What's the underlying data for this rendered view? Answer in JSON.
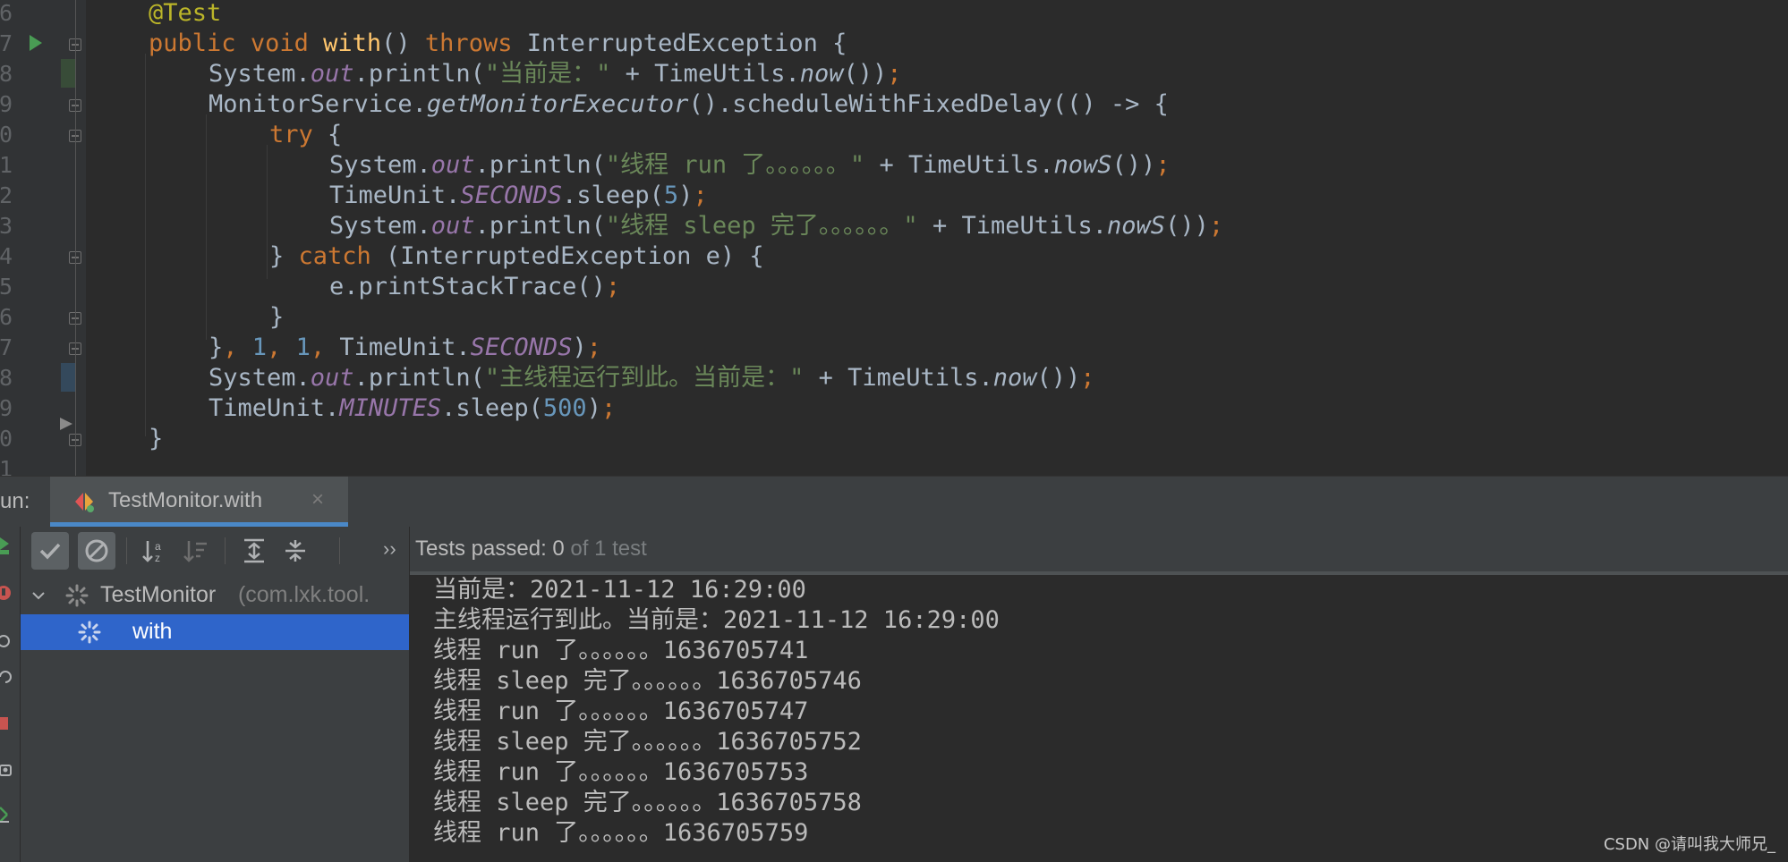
{
  "editor": {
    "line_numbers": [
      "6",
      "7",
      "8",
      "9",
      "0",
      "1",
      "2",
      "3",
      "4",
      "5",
      "6",
      "7",
      "8",
      "9",
      "0",
      "1"
    ],
    "code": {
      "l6": {
        "annotation": "@Test"
      },
      "l7": {
        "kw1": "public",
        "kw2": "void",
        "method": "with",
        "p1": "()",
        "kw3": "throws",
        "rest": "InterruptedException {"
      },
      "l8": {
        "t1": "System.",
        "field": "out",
        "t2": ".println(",
        "str": "\"当前是：\"",
        "t3": " + TimeUtils.",
        "stat": "now",
        "t4": "())",
        "semi": ";"
      },
      "l9": {
        "t1": "MonitorService.",
        "stat": "getMonitorExecutor",
        "t2": "().scheduleWithFixedDelay(() -> {"
      },
      "l10": {
        "kw": "try",
        "t1": " {"
      },
      "l11": {
        "t1": "System.",
        "field": "out",
        "t2": ".println(",
        "str": "\"线程 run 了。。。。。。\"",
        "t3": " + TimeUtils.",
        "stat": "nowS",
        "t4": "())",
        "semi": ";"
      },
      "l12": {
        "t1": "TimeUnit.",
        "const": "SECONDS",
        "t2": ".sleep(",
        "num": "5",
        "t3": ")",
        "semi": ";"
      },
      "l13": {
        "t1": "System.",
        "field": "out",
        "t2": ".println(",
        "str": "\"线程 sleep 完了。。。。。。\"",
        "t3": " + TimeUtils.",
        "stat": "nowS",
        "t4": "())",
        "semi": ";"
      },
      "l14": {
        "t1": "} ",
        "kw": "catch",
        "t2": " (InterruptedException e) {"
      },
      "l15": {
        "t1": "e.printStackTrace()",
        "semi": ";"
      },
      "l16": {
        "t1": "}"
      },
      "l17": {
        "t1": "}",
        "c1": ", ",
        "n1": "1",
        "c2": ", ",
        "n2": "1",
        "c3": ", ",
        "t2": "TimeUnit.",
        "const": "SECONDS",
        "t3": ")",
        "semi": ";"
      },
      "l18": {
        "t1": "System.",
        "field": "out",
        "t2": ".println(",
        "str": "\"主线程运行到此。当前是：\"",
        "t3": " + TimeUtils.",
        "stat": "now",
        "t4": "())",
        "semi": ";"
      },
      "l19": {
        "t1": "TimeUnit.",
        "const": "MINUTES",
        "t2": ".sleep(",
        "num": "500",
        "t3": ")",
        "semi": ";"
      },
      "l20": {
        "t1": "}"
      }
    }
  },
  "run_panel": {
    "label": "un:",
    "tab_title": "TestMonitor.with",
    "tab_close": "×",
    "status_prefix": "Tests passed: 0",
    "status_suffix": " of 1 test",
    "expand_glyph": "››",
    "tree": [
      {
        "label": "TestMonitor",
        "detail": " (com.lxk.tool.",
        "expanded": true
      },
      {
        "label": "with",
        "selected": true
      }
    ],
    "output": [
      "当前是：2021-11-12 16:29:00",
      "主线程运行到此。当前是：2021-11-12 16:29:00",
      "线程 run 了。。。。。。1636705741",
      "线程 sleep 完了。。。。。。1636705746",
      "线程 run 了。。。。。。1636705747",
      "线程 sleep 完了。。。。。。1636705752",
      "线程 run 了。。。。。。1636705753",
      "线程 sleep 完了。。。。。。1636705758",
      "线程 run 了。。。。。。1636705759"
    ]
  },
  "watermark": "CSDN @请叫我大师兄_",
  "colors": {
    "keyword": "#cc7832",
    "annotation": "#bbb529",
    "method": "#ffc66d",
    "string": "#6a8759",
    "number": "#6897bb",
    "field": "#9876aa",
    "selection": "#2f65ca",
    "tab_underline": "#4a88c7"
  }
}
